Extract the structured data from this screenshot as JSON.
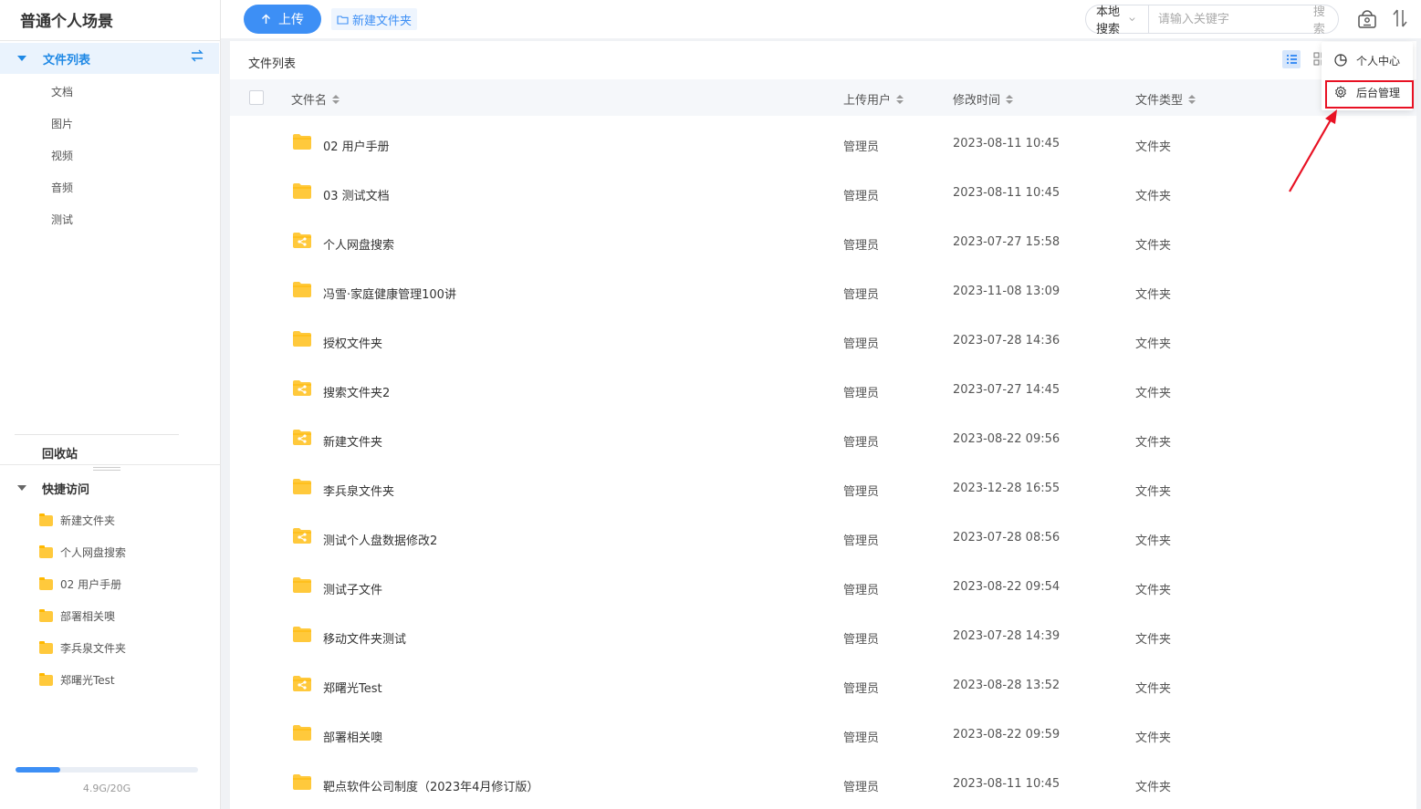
{
  "sidebar": {
    "app_title": "普通个人场景",
    "file_list_label": "文件列表",
    "sub_items": [
      "文档",
      "图片",
      "视频",
      "音频",
      "测试"
    ],
    "recycle_label": "回收站",
    "quick_access_label": "快捷访问",
    "quick_items": [
      "新建文件夹",
      "个人网盘搜索",
      "02 用户手册",
      "部署相关噢",
      "李兵泉文件夹",
      "郑曙光Test"
    ],
    "storage": {
      "used_fraction": 0.245,
      "text": "4.9G/20G"
    }
  },
  "toolbar": {
    "upload_label": "上传",
    "new_folder_label": "新建文件夹",
    "search_scope": "本地搜索",
    "search_placeholder": "请输入关键字",
    "search_button": "搜索"
  },
  "main": {
    "title": "文件列表",
    "columns": {
      "name": "文件名",
      "user": "上传用户",
      "time": "修改时间",
      "type": "文件类型"
    },
    "rows": [
      {
        "name": "02 用户手册",
        "user": "管理员",
        "time": "2023-08-11 10:45",
        "type": "文件夹",
        "shared": false
      },
      {
        "name": "03 测试文档",
        "user": "管理员",
        "time": "2023-08-11 10:45",
        "type": "文件夹",
        "shared": false
      },
      {
        "name": "个人网盘搜索",
        "user": "管理员",
        "time": "2023-07-27 15:58",
        "type": "文件夹",
        "shared": true
      },
      {
        "name": "冯雪·家庭健康管理100讲",
        "user": "管理员",
        "time": "2023-11-08 13:09",
        "type": "文件夹",
        "shared": false
      },
      {
        "name": "授权文件夹",
        "user": "管理员",
        "time": "2023-07-28 14:36",
        "type": "文件夹",
        "shared": false
      },
      {
        "name": "搜索文件夹2",
        "user": "管理员",
        "time": "2023-07-27 14:45",
        "type": "文件夹",
        "shared": true
      },
      {
        "name": "新建文件夹",
        "user": "管理员",
        "time": "2023-08-22 09:56",
        "type": "文件夹",
        "shared": true
      },
      {
        "name": "李兵泉文件夹",
        "user": "管理员",
        "time": "2023-12-28 16:55",
        "type": "文件夹",
        "shared": false
      },
      {
        "name": "测试个人盘数据修改2",
        "user": "管理员",
        "time": "2023-07-28 08:56",
        "type": "文件夹",
        "shared": true
      },
      {
        "name": "测试子文件",
        "user": "管理员",
        "time": "2023-08-22 09:54",
        "type": "文件夹",
        "shared": false
      },
      {
        "name": "移动文件夹测试",
        "user": "管理员",
        "time": "2023-07-28 14:39",
        "type": "文件夹",
        "shared": false
      },
      {
        "name": "郑曙光Test",
        "user": "管理员",
        "time": "2023-08-28 13:52",
        "type": "文件夹",
        "shared": true
      },
      {
        "name": "部署相关噢",
        "user": "管理员",
        "time": "2023-08-22 09:59",
        "type": "文件夹",
        "shared": false
      },
      {
        "name": "靶点软件公司制度（2023年4月修订版）",
        "user": "管理员",
        "time": "2023-08-11 10:45",
        "type": "文件夹",
        "shared": false
      }
    ]
  },
  "user_menu": {
    "items": [
      {
        "label": "个人中心",
        "icon": "pie-chart-icon"
      },
      {
        "label": "后台管理",
        "icon": "gear-icon"
      }
    ]
  },
  "colors": {
    "accent": "#3d8ff5",
    "folder": "#ffc93c",
    "annotation": "#e81123"
  }
}
